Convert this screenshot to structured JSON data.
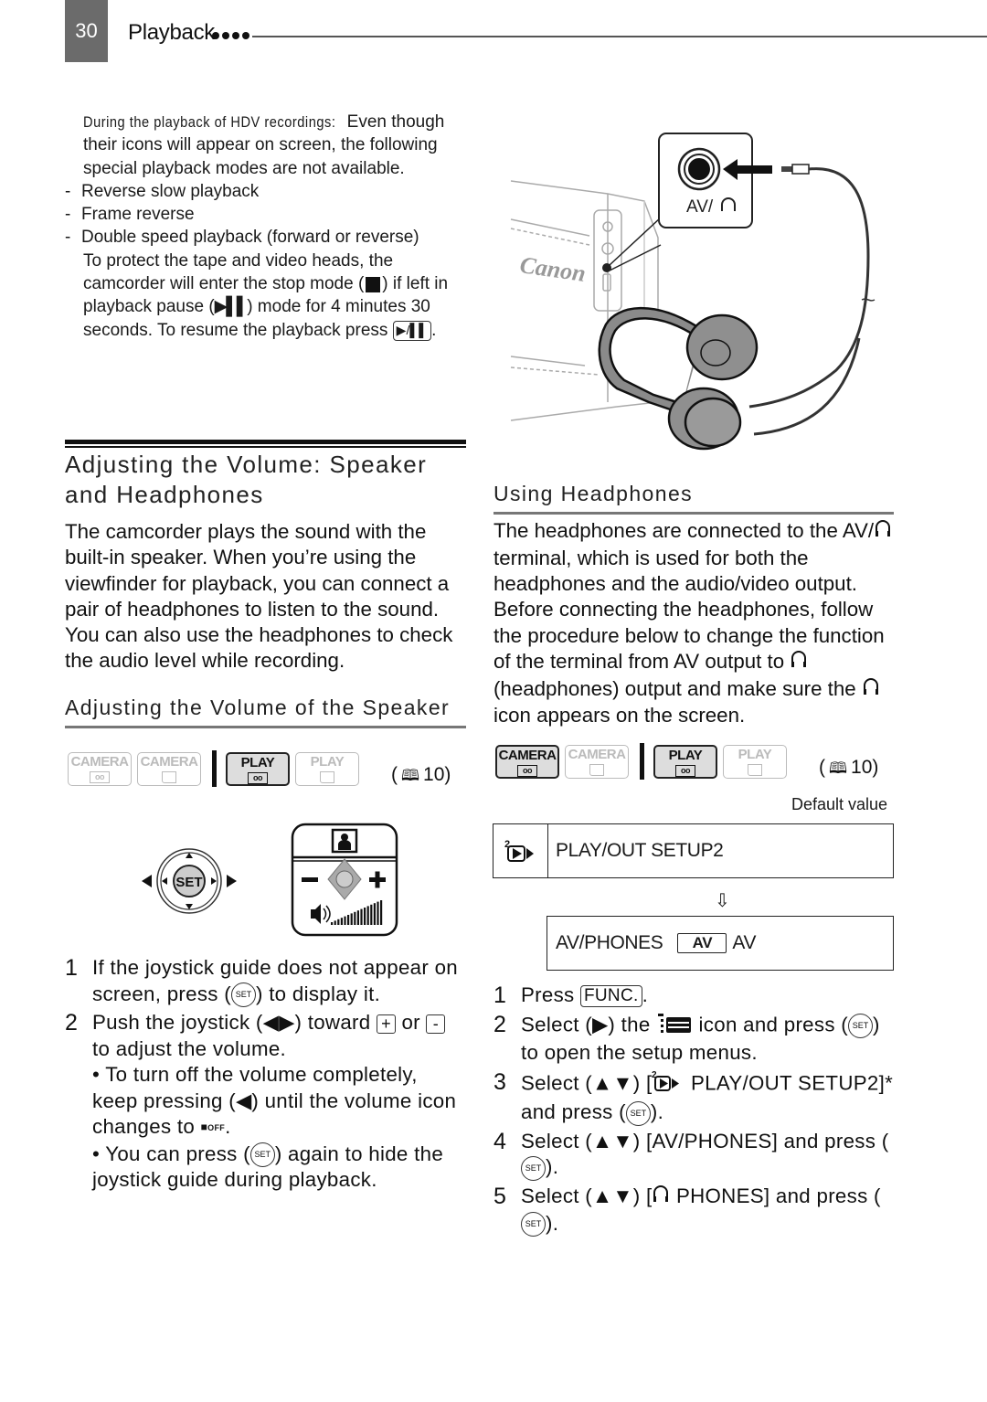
{
  "header": {
    "page_number": "30",
    "title": "Playback"
  },
  "note": {
    "lead": "During the playback of HDV recordings:",
    "text1": " Even though their icons will appear on screen, the following special playback modes are not available.",
    "items": [
      "Reverse slow playback",
      "Frame reverse",
      "Double speed playback (forward or reverse)"
    ],
    "p2_a": "To protect the tape and video heads, the camcorder will enter the stop mode (",
    "p2_b": ") if left in playback pause (",
    "p2_c": ") mode for 4 minutes 30 seconds. To resume the playback press ",
    "p2_d": "."
  },
  "section": {
    "title": "Adjusting the Volume: Speaker and Headphones",
    "intro": "The camcorder plays the sound with the built-in speaker. When you’re using the viewfinder for playback, you can connect a pair of headphones to listen to the sound. You can also use the headphones to check the audio level while recording."
  },
  "speaker": {
    "title": "Adjusting the Volume of the Speaker",
    "modes": [
      {
        "label": "CAMERA",
        "media": "tape",
        "active": false
      },
      {
        "label": "CAMERA",
        "media": "card",
        "active": false
      },
      {
        "label": "PLAY",
        "media": "tape",
        "active": true
      },
      {
        "label": "PLAY",
        "media": "card",
        "active": false
      }
    ],
    "ref": "10",
    "set_label": "SET",
    "steps": [
      {
        "n": "1",
        "a": "If the joystick guide does not appear on screen, press (",
        "b": ") to display it."
      },
      {
        "n": "2",
        "a": "Push the joystick (◀▶) toward ",
        "b": " or ",
        "c": " to adjust the volume."
      }
    ],
    "bullet1_a": "• To turn off the volume completely, keep pressing (◀) until the volume icon changes to ",
    "bullet1_b": ".",
    "bullet2_a": "• You can press (",
    "bullet2_b": ") again to hide the joystick guide during playback.",
    "off_label": "OFF"
  },
  "headphones": {
    "title": "Using Headphones",
    "intro_a": "The headphones are connected to the AV/",
    "intro_b": " terminal, which is used for both the headphones and the audio/video output. Before connecting the headphones, follow the procedure below to change the function of the terminal from AV output to ",
    "intro_c": " (headphones) output and make sure the ",
    "intro_d": " icon appears on the screen.",
    "modes": [
      {
        "label": "CAMERA",
        "media": "tape",
        "active": true
      },
      {
        "label": "CAMERA",
        "media": "card",
        "active": false
      },
      {
        "label": "PLAY",
        "media": "tape",
        "active": true
      },
      {
        "label": "PLAY",
        "media": "card",
        "active": false
      }
    ],
    "ref": "10",
    "default_value": "Default value",
    "menu_row1": "PLAY/OUT SETUP2",
    "menu_row2_label": "AV/PHONES",
    "menu_row2_badge": "AV",
    "menu_row2_value": "AV",
    "steps": [
      {
        "n": "1",
        "a": "Press ",
        "btn": "FUNC.",
        "b": "."
      },
      {
        "n": "2",
        "a": "Select (▶) the ",
        "b": " icon and press (",
        "c": ") to open the setup menus."
      },
      {
        "n": "3",
        "a": "Select (▲▼) [",
        "b": " PLAY/OUT SETUP2]* and press (",
        "c": ")."
      },
      {
        "n": "4",
        "a": "Select (▲▼) [AV/PHONES] and press (",
        "b": ")."
      },
      {
        "n": "5",
        "a": "Select (▲▼) [",
        "b": " PHONES] and press (",
        "c": ")."
      }
    ]
  },
  "illustration": {
    "terminal_label": "AV/",
    "brand": "Canon"
  }
}
